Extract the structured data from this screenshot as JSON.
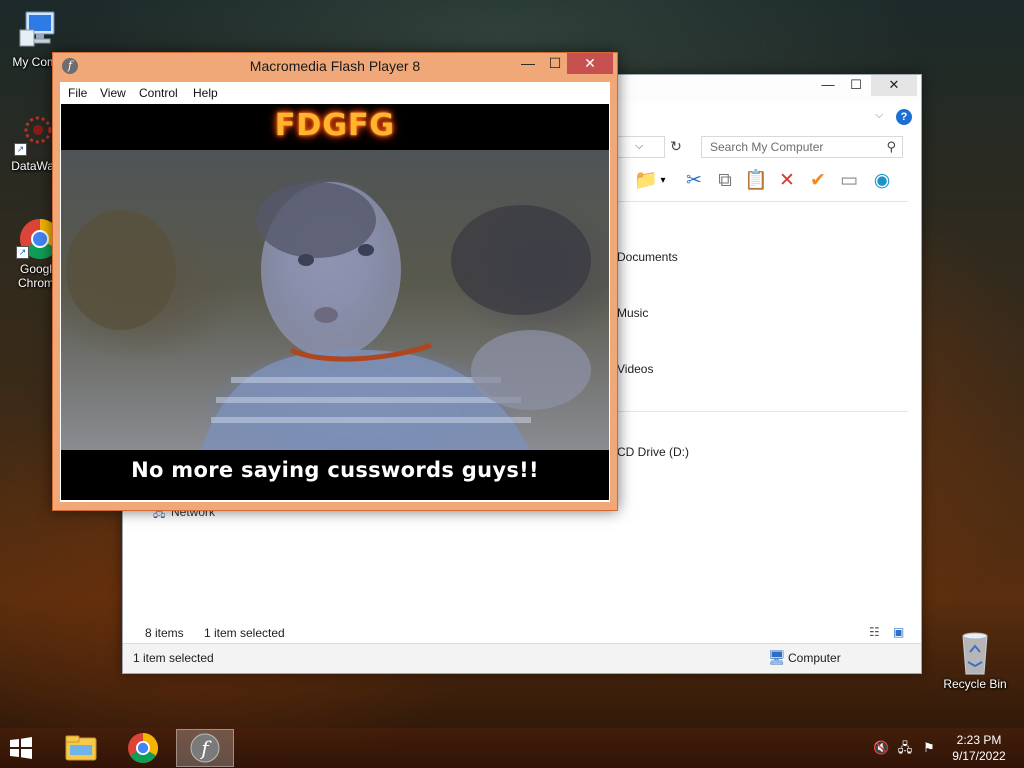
{
  "desktop": {
    "icons": [
      {
        "label": "My Comp",
        "icon": "computer-icon"
      },
      {
        "label": "DataWag",
        "icon": "datawag-icon"
      },
      {
        "label": "Googl Chrom",
        "icon": "chrome-icon"
      },
      {
        "label": "Recycle Bin",
        "icon": "recycle-bin-icon"
      }
    ]
  },
  "explorer": {
    "search_placeholder": "Search My Computer",
    "items": [
      "Documents",
      "Music",
      "Videos",
      "CD Drive (D:)",
      "Network"
    ],
    "status_items": "8 items",
    "status_selected": "1 item selected",
    "details_selected": "1 item selected",
    "details_location": "Computer",
    "help_glyph": "?"
  },
  "flash": {
    "title": "Macromedia Flash Player 8",
    "menu": [
      "File",
      "View",
      "Control",
      "Help"
    ],
    "video": {
      "title_text": "FDGFG",
      "caption": "No more saying cusswords guys!!"
    }
  },
  "taskbar": {
    "time": "2:23 PM",
    "date": "9/17/2022",
    "apps": [
      "file-explorer-icon",
      "chrome-icon",
      "flash-player-icon"
    ]
  },
  "colors": {
    "flash_frame": "#f0a878",
    "flash_close": "#c75050",
    "accent_blue": "#1464c8"
  }
}
